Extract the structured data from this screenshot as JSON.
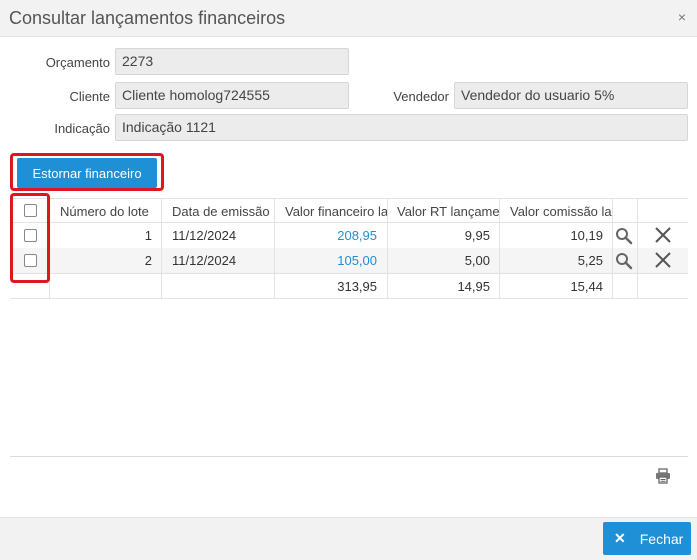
{
  "dialog": {
    "title": "Consultar lançamentos financeiros",
    "close_glyph": "×"
  },
  "form": {
    "orcamento": {
      "label": "Orçamento",
      "value": "2273"
    },
    "cliente": {
      "label": "Cliente",
      "value": "Cliente homolog724555"
    },
    "vendedor": {
      "label": "Vendedor",
      "value": "Vendedor do usuario 5%"
    },
    "indicacao": {
      "label": "Indicação",
      "value": "Indicação 1121"
    }
  },
  "actions": {
    "estornar_label": "Estornar financeiro"
  },
  "table": {
    "columns": [
      "Número do lote",
      "Data de emissão",
      "Valor financeiro la",
      "Valor RT lançamer",
      "Valor comissão lar"
    ],
    "rows": [
      {
        "lote": "1",
        "data": "11/12/2024",
        "valor_financeiro": "208,95",
        "valor_rt": "9,95",
        "valor_comissao": "10,19",
        "checked": false
      },
      {
        "lote": "2",
        "data": "11/12/2024",
        "valor_financeiro": "105,00",
        "valor_rt": "5,00",
        "valor_comissao": "5,25",
        "checked": false
      }
    ],
    "totals": {
      "valor_financeiro": "313,95",
      "valor_rt": "14,95",
      "valor_comissao": "15,44"
    }
  },
  "footer": {
    "close_label": "Fechar",
    "close_glyph": "✕"
  },
  "icons": {
    "row_actions": [
      "search-icon",
      "delete-icon"
    ],
    "print": "print-icon"
  },
  "colors": {
    "accent": "#1f8fd6",
    "highlight": "#e0161e",
    "link": "#1f8fd6"
  }
}
